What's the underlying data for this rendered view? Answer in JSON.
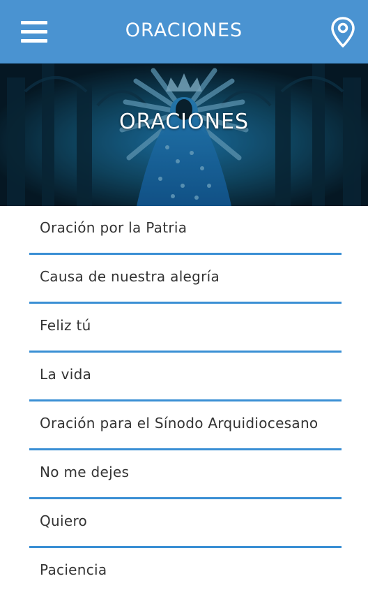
{
  "appbar": {
    "title": "ORACIONES",
    "background_color": "#4a93d1",
    "menu_icon": "hamburger-menu-icon",
    "location_icon": "map-pin-icon"
  },
  "hero": {
    "title": "ORACIONES",
    "image_description_icon": "virgin-statue-image"
  },
  "list": {
    "divider_color": "#3a8fd4",
    "items": [
      {
        "label": "Oración por la Patria"
      },
      {
        "label": "Causa de nuestra alegría"
      },
      {
        "label": "Feliz tú"
      },
      {
        "label": "La vida"
      },
      {
        "label": "Oración para el Sínodo Arquidiocesano"
      },
      {
        "label": "No me dejes"
      },
      {
        "label": "Quiero"
      },
      {
        "label": "Paciencia"
      }
    ]
  }
}
